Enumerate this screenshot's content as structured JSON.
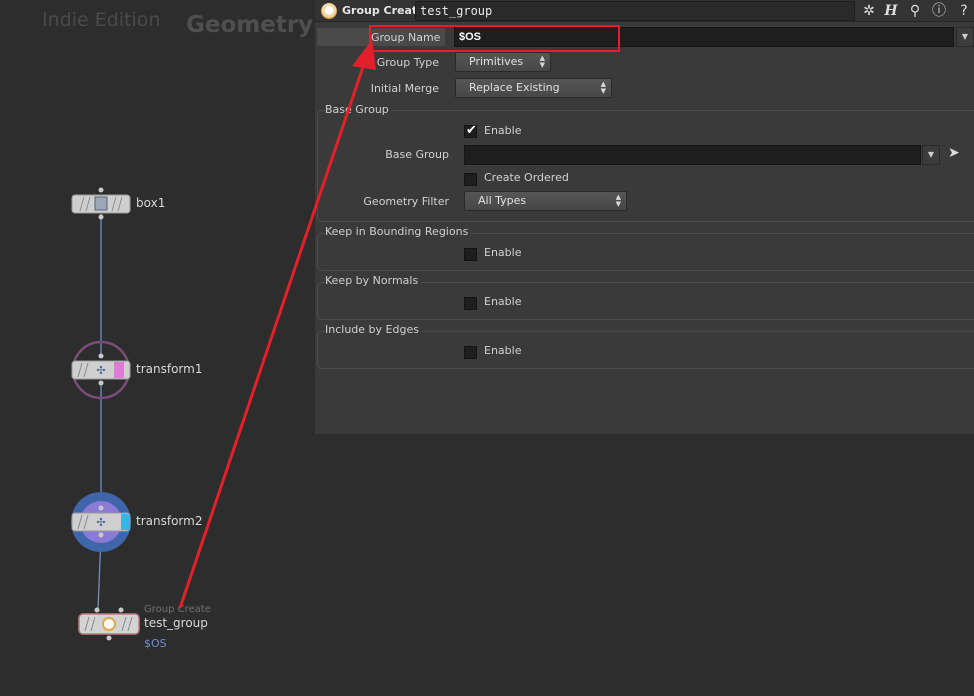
{
  "network": {
    "watermark_edition": "Indie Edition",
    "watermark_context": "Geometry",
    "nodes": [
      {
        "name": "box1"
      },
      {
        "name": "transform1"
      },
      {
        "name": "transform2"
      },
      {
        "name": "test_group",
        "type_label": "Group Create",
        "comment": "$OS"
      }
    ]
  },
  "toolbar": {
    "op_type": "Group Create",
    "node_name": "test_group",
    "icons": [
      "gear-icon",
      "houdini-help-icon",
      "search-icon",
      "info-icon",
      "question-icon"
    ]
  },
  "params": {
    "group_name": {
      "label": "Group Name",
      "value": "$OS"
    },
    "group_type": {
      "label": "Group Type",
      "value": "Primitives"
    },
    "initial_merge": {
      "label": "Initial Merge",
      "value": "Replace Existing"
    },
    "base_group_folder": {
      "title": "Base Group",
      "enable_label": "Enable",
      "enable_checked": true,
      "base_group_label": "Base Group",
      "base_group_value": "",
      "create_ordered_label": "Create Ordered",
      "create_ordered_checked": false,
      "geometry_filter_label": "Geometry Filter",
      "geometry_filter_value": "All Types"
    },
    "bounding_folder": {
      "title": "Keep in Bounding Regions",
      "enable_label": "Enable",
      "enable_checked": false
    },
    "normals_folder": {
      "title": "Keep by Normals",
      "enable_label": "Enable",
      "enable_checked": false
    },
    "edges_folder": {
      "title": "Include by Edges",
      "enable_label": "Enable",
      "enable_checked": false
    }
  },
  "colors": {
    "annotation_red": "#e3202a",
    "wire_blue": "#6f8fbd",
    "transform1_flag": "#e07ad8",
    "transform2_flag": "#35b6e8"
  }
}
